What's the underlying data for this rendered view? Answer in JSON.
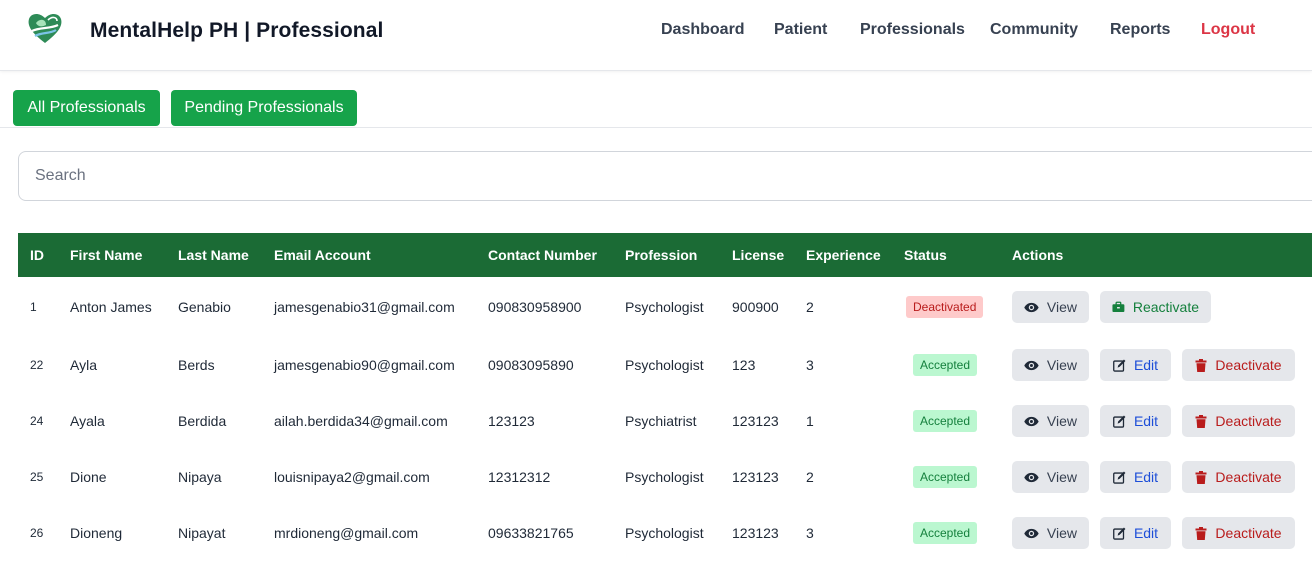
{
  "header": {
    "brand": "MentalHelp PH | Professional",
    "nav": [
      "Dashboard",
      "Patient",
      "Professionals",
      "Community",
      "Reports",
      "Logout"
    ]
  },
  "tabs": {
    "all": "All Professionals",
    "pending": "Pending Professionals"
  },
  "search": {
    "placeholder": "Search",
    "value": ""
  },
  "table": {
    "headers": [
      "ID",
      "First Name",
      "Last Name",
      "Email Account",
      "Contact Number",
      "Profession",
      "License",
      "Experience",
      "Status",
      "Actions"
    ],
    "rows": [
      {
        "id": "1",
        "first": "Anton James",
        "last": "Genabio",
        "email": "jamesgenabio31@gmail.com",
        "contact": "090830958900",
        "profession": "Psychologist",
        "license": "900900",
        "experience": "2",
        "status": "Deactivated"
      },
      {
        "id": "22",
        "first": "Ayla",
        "last": "Berds",
        "email": "jamesgenabio90@gmail.com",
        "contact": "09083095890",
        "profession": "Psychologist",
        "license": "123",
        "experience": "3",
        "status": "Accepted"
      },
      {
        "id": "24",
        "first": "Ayala",
        "last": "Berdida",
        "email": "ailah.berdida34@gmail.com",
        "contact": "123123",
        "profession": "Psychiatrist",
        "license": "123123",
        "experience": "1",
        "status": "Accepted"
      },
      {
        "id": "25",
        "first": "Dione",
        "last": "Nipaya",
        "email": "louisnipaya2@gmail.com",
        "contact": "12312312",
        "profession": "Psychologist",
        "license": "123123",
        "experience": "2",
        "status": "Accepted"
      },
      {
        "id": "26",
        "first": "Dioneng",
        "last": "Nipayat",
        "email": "mrdioneng@gmail.com",
        "contact": "09633821765",
        "profession": "Psychologist",
        "license": "123123",
        "experience": "3",
        "status": "Accepted"
      }
    ]
  },
  "actions": {
    "view": "View",
    "edit": "Edit",
    "deactivate": "Deactivate",
    "reactivate": "Reactivate"
  },
  "colors": {
    "primary_green": "#16a34a",
    "table_header": "#1b6b35",
    "logout_red": "#dc3545"
  },
  "icons": {
    "logo": "heart-leaf-logo",
    "view": "eye-icon",
    "edit": "edit-icon",
    "deactivate": "trash-icon",
    "reactivate": "briefcase-icon"
  }
}
